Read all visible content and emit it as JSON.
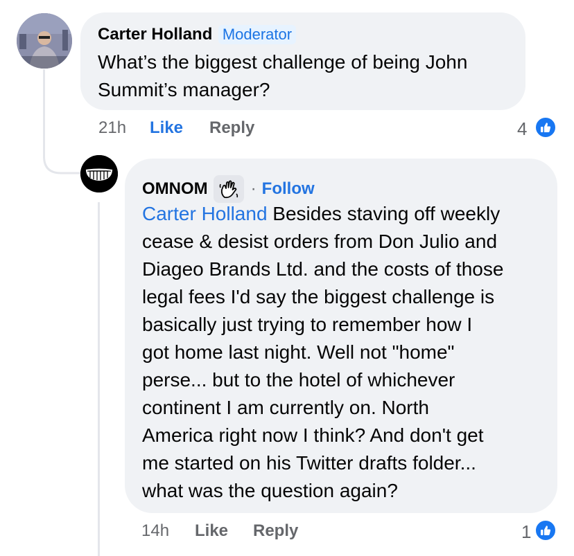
{
  "comment_1": {
    "author": "Carter Holland",
    "badge": "Moderator",
    "text": "What’s the biggest challenge of being John\nSummit’s manager?",
    "time": "21h",
    "like_label": "Like",
    "reply_label": "Reply",
    "reaction_count": "4"
  },
  "comment_2": {
    "author": "OMNOM",
    "separator": "·",
    "follow_label": "Follow",
    "mention": "Carter Holland",
    "text": " Besides staving off weekly\ncease & desist orders from Don Julio and\nDiageo Brands Ltd. and the costs of those\nlegal fees I'd say the biggest challenge is\nbasically just trying to remember how I\ngot home last night. Well not \"home\"\nperse... but to the hotel of whichever\ncontinent I am currently on. North\nAmerica right now I think? And don't get\nme started on his Twitter drafts folder...\nwhat was the question again?",
    "time": "14h",
    "like_label": "Like",
    "reply_label": "Reply",
    "reaction_count": "1"
  },
  "icons": {
    "reaction": "thumbs-up-icon",
    "author_badge": "waving-hand-icon"
  },
  "colors": {
    "link_blue": "#2374e1",
    "like_blue": "#1877f2",
    "bubble_bg": "#f0f2f5",
    "meta_gray": "#65676b"
  }
}
